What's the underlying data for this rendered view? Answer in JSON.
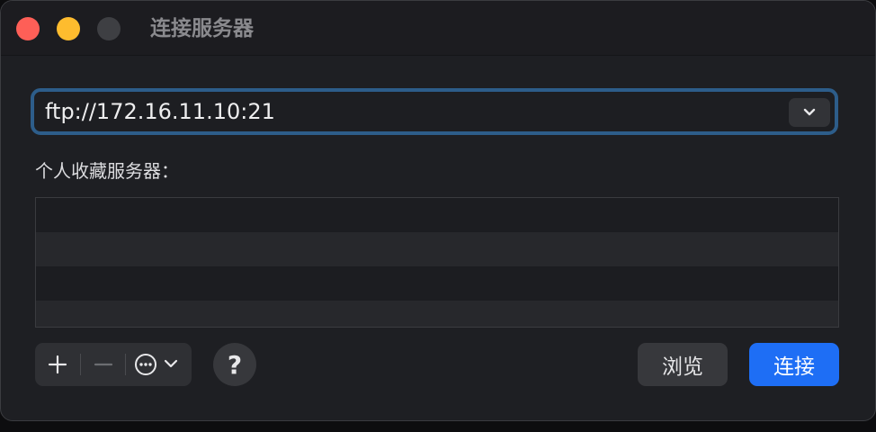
{
  "window": {
    "title": "连接服务器"
  },
  "address": {
    "value": "ftp://172.16.11.10:21"
  },
  "favorites": {
    "label": "个人收藏服务器：",
    "rows": [
      "",
      "",
      "",
      ""
    ]
  },
  "toolbar": {
    "add_icon": "plus-icon",
    "remove_icon": "minus-icon",
    "more_icon": "ellipsis-circle-icon",
    "help_label": "?"
  },
  "buttons": {
    "browse_label": "浏览",
    "connect_label": "连接"
  },
  "colors": {
    "accent": "#1e6ef5",
    "focus_ring": "#2d5d8a",
    "close": "#fe5f57",
    "minimize": "#febc2e"
  }
}
